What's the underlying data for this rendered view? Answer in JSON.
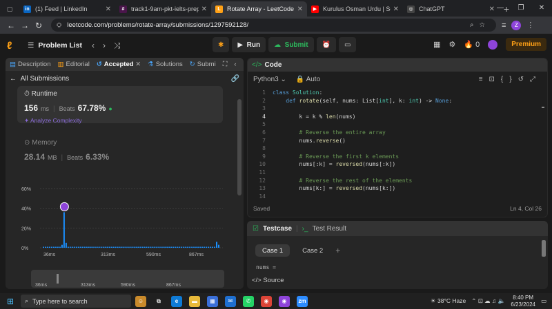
{
  "browser": {
    "tabs": [
      {
        "title": "(1) Feed | LinkedIn",
        "icon": "linkedin-icon",
        "color": "#0a66c2",
        "glyph": "in"
      },
      {
        "title": "track1-9am-pkt-ielts-prep-",
        "icon": "slack-icon",
        "color": "#4a154b",
        "glyph": "#"
      },
      {
        "title": "Rotate Array - LeetCode",
        "icon": "leetcode-icon",
        "color": "#ffa116",
        "glyph": "L"
      },
      {
        "title": "Kurulus Osman Urdu | Seaso",
        "icon": "youtube-icon",
        "color": "#ff0000",
        "glyph": "▶"
      },
      {
        "title": "ChatGPT",
        "icon": "chatgpt-icon",
        "color": "#444",
        "glyph": "◎"
      }
    ],
    "url": "leetcode.com/problems/rotate-array/submissions/1297592128/",
    "profile_initial": "Z"
  },
  "lc_nav": {
    "problem_list": "Problem List",
    "run": "Run",
    "submit": "Submit",
    "streak": "0",
    "premium": "Premium"
  },
  "left": {
    "tabs": [
      "Description",
      "Editorial",
      "Accepted",
      "Solutions",
      "Submi"
    ],
    "back": "All Submissions",
    "runtime": {
      "label": "Runtime",
      "value": "156",
      "unit": "ms",
      "beats_label": "Beats",
      "beats": "67.78%",
      "analyze": "Analyze Complexity"
    },
    "memory": {
      "label": "Memory",
      "value": "28.14",
      "unit": "MB",
      "beats_label": "Beats",
      "beats": "6.33%"
    }
  },
  "chart_data": {
    "type": "bar",
    "ylim": [
      0,
      60
    ],
    "yticks": [
      "0%",
      "20%",
      "40%",
      "60%"
    ],
    "xticks": [
      "36ms",
      "313ms",
      "590ms",
      "867ms"
    ],
    "minimap_xticks": [
      "36ms",
      "313ms",
      "590ms",
      "867ms"
    ],
    "values": [
      1,
      1,
      1,
      1,
      1,
      1,
      1,
      1,
      1,
      3,
      36,
      5,
      1,
      1,
      1,
      1,
      1,
      1,
      1,
      1,
      1,
      1,
      1,
      1,
      1,
      1,
      1,
      1,
      1,
      1,
      1,
      1,
      1,
      1,
      1,
      1,
      1,
      1,
      1,
      1,
      1,
      1,
      1,
      1,
      1,
      1,
      1,
      1,
      1,
      1,
      1,
      1,
      1,
      1,
      1,
      1,
      1,
      1,
      1,
      1,
      1,
      1,
      1,
      1,
      1,
      1,
      1,
      1,
      1,
      1,
      1,
      1,
      1,
      1,
      1,
      1,
      1,
      1,
      1,
      1,
      1,
      1,
      1,
      1,
      6,
      3
    ],
    "highlight_index": 10,
    "grid": true,
    "bar_color": "#1a90ff"
  },
  "code": {
    "header": "Code",
    "language": "Python3",
    "mode": "Auto",
    "lines": [
      {
        "n": "1",
        "parts": [
          [
            "kw",
            "class "
          ],
          [
            "ty",
            "Solution"
          ],
          [
            "",
            ""
          ],
          [
            "",
            ":"
          ]
        ]
      },
      {
        "n": "2",
        "parts": [
          [
            "",
            "    "
          ],
          [
            "kw",
            "def "
          ],
          [
            "fn",
            "rotate"
          ],
          [
            "",
            "(self, nums: List["
          ],
          [
            "ty",
            "int"
          ],
          [
            "",
            "], k: "
          ],
          [
            "ty",
            "int"
          ],
          [
            "",
            ") -> "
          ],
          [
            "kw",
            "None"
          ],
          [
            "",
            ":"
          ]
        ]
      },
      {
        "n": "3",
        "parts": [
          [
            "",
            ""
          ]
        ]
      },
      {
        "n": "4",
        "parts": [
          [
            "",
            "        k = k % "
          ],
          [
            "fn",
            "len"
          ],
          [
            "",
            "(nums)"
          ]
        ]
      },
      {
        "n": "5",
        "parts": [
          [
            "",
            ""
          ]
        ]
      },
      {
        "n": "6",
        "parts": [
          [
            "",
            "        "
          ],
          [
            "cm",
            "# Reverse the entire array"
          ]
        ]
      },
      {
        "n": "7",
        "parts": [
          [
            "",
            "        nums."
          ],
          [
            "fn",
            "reverse"
          ],
          [
            "",
            "()"
          ]
        ]
      },
      {
        "n": "8",
        "parts": [
          [
            "",
            ""
          ]
        ]
      },
      {
        "n": "9",
        "parts": [
          [
            "",
            "        "
          ],
          [
            "cm",
            "# Reverse the first k elements"
          ]
        ]
      },
      {
        "n": "10",
        "parts": [
          [
            "",
            "        nums[:k] = "
          ],
          [
            "fn",
            "reversed"
          ],
          [
            "",
            "(nums[:k])"
          ]
        ]
      },
      {
        "n": "11",
        "parts": [
          [
            "",
            ""
          ]
        ]
      },
      {
        "n": "12",
        "parts": [
          [
            "",
            "        "
          ],
          [
            "cm",
            "# Reverse the rest of the elements"
          ]
        ]
      },
      {
        "n": "13",
        "parts": [
          [
            "",
            "        nums[k:] = "
          ],
          [
            "fn",
            "reversed"
          ],
          [
            "",
            "(nums[k:])"
          ]
        ]
      },
      {
        "n": "14",
        "parts": [
          [
            "",
            ""
          ]
        ]
      }
    ],
    "current_line": "4",
    "status": "Saved",
    "cursor": "Ln 4, Col 26"
  },
  "testcase": {
    "tab": "Testcase",
    "result_tab": "Test Result",
    "cases": [
      "Case 1",
      "Case 2"
    ],
    "field": "nums =",
    "source": "Source"
  },
  "taskbar": {
    "search_placeholder": "Type here to search",
    "weather": "38°C  Haze",
    "time": "8:40 PM",
    "date": "6/23/2024"
  }
}
